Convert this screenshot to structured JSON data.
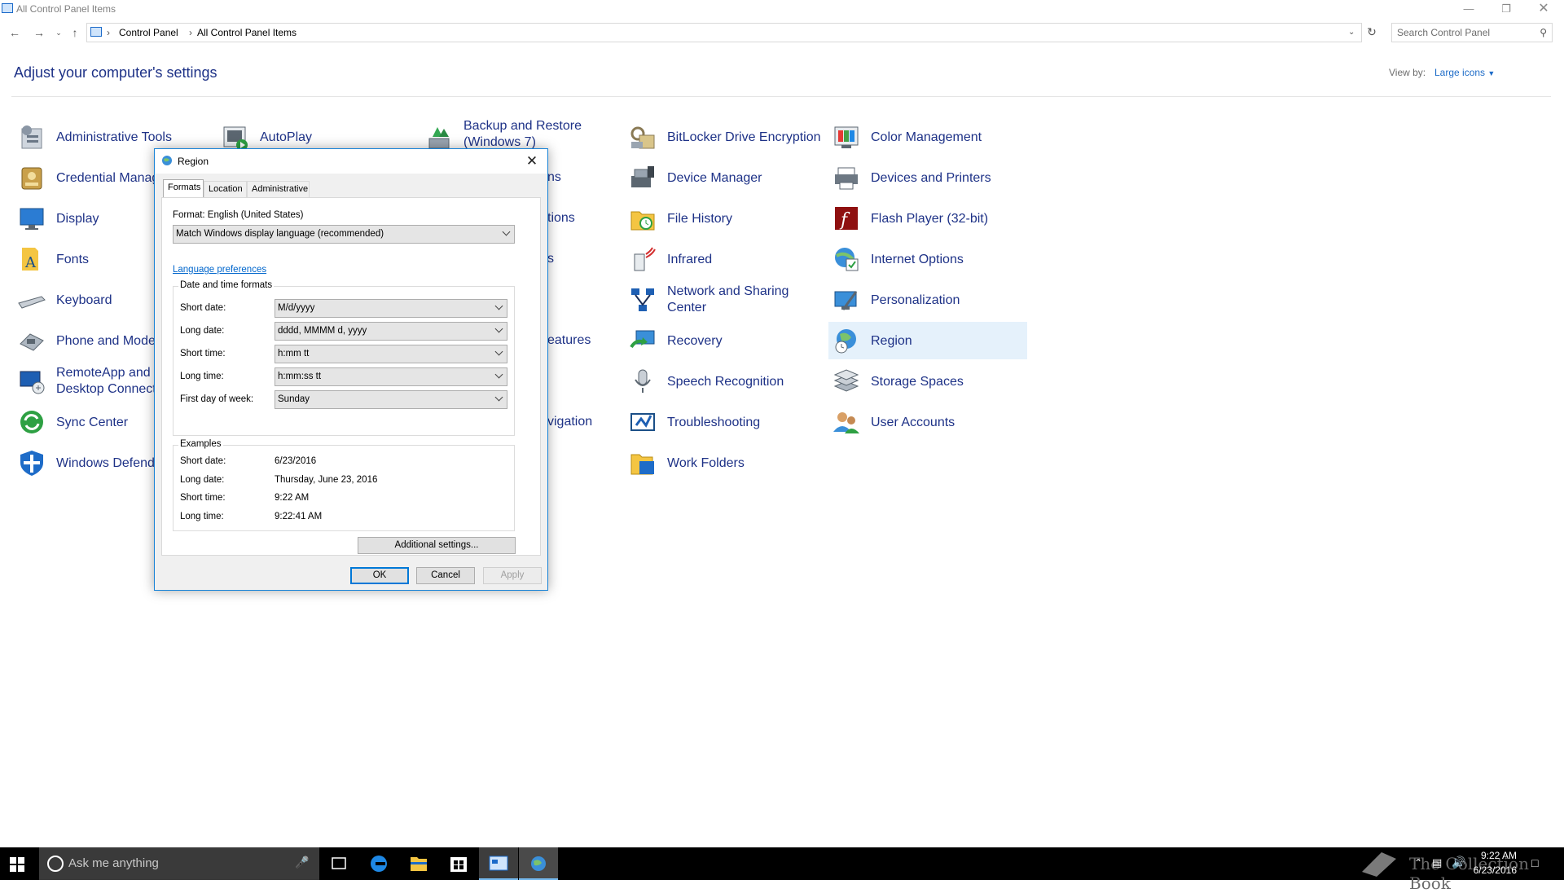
{
  "window": {
    "title": "All Control Panel Items",
    "minimize_icon": "minimize-icon",
    "maximize_icon": "restore-icon",
    "close_icon": "close-icon"
  },
  "address": {
    "crumbs": [
      "Control Panel",
      "All Control Panel Items"
    ],
    "search_placeholder": "Search Control Panel"
  },
  "header": {
    "title": "Adjust your computer's settings",
    "view_by_label": "View by:",
    "view_by_value": "Large icons"
  },
  "items": [
    {
      "label": "Administrative Tools",
      "icon": "admin-tools-icon"
    },
    {
      "label": "AutoPlay",
      "icon": "autoplay-icon"
    },
    {
      "label": "Backup and Restore (Windows 7)",
      "icon": "backup-icon"
    },
    {
      "label": "BitLocker Drive Encryption",
      "icon": "bitlocker-icon"
    },
    {
      "label": "Color Management",
      "icon": "color-management-icon"
    },
    {
      "label": "Credential Manager",
      "icon": "credential-icon"
    },
    {
      "label": "Device Manager",
      "icon": "device-manager-icon"
    },
    {
      "label": "Devices and Printers",
      "icon": "printer-icon"
    },
    {
      "label": "Display",
      "icon": "display-icon"
    },
    {
      "label": "File History",
      "icon": "file-history-icon"
    },
    {
      "label": "Flash Player (32-bit)",
      "icon": "flash-icon"
    },
    {
      "label": "Fonts",
      "icon": "fonts-icon"
    },
    {
      "label": "Infrared",
      "icon": "infrared-icon"
    },
    {
      "label": "Internet Options",
      "icon": "internet-options-icon"
    },
    {
      "label": "Keyboard",
      "icon": "keyboard-icon"
    },
    {
      "label": "Network and Sharing Center",
      "icon": "network-icon"
    },
    {
      "label": "Personalization",
      "icon": "personalization-icon"
    },
    {
      "label": "Phone and Modem",
      "icon": "phone-icon"
    },
    {
      "label": "Recovery",
      "icon": "recovery-icon"
    },
    {
      "label": "Region",
      "icon": "region-icon"
    },
    {
      "label": "RemoteApp and Desktop Connections",
      "icon": "remoteapp-icon"
    },
    {
      "label": "Speech Recognition",
      "icon": "microphone-icon"
    },
    {
      "label": "Storage Spaces",
      "icon": "storage-icon"
    },
    {
      "label": "Sync Center",
      "icon": "sync-icon"
    },
    {
      "label": "Troubleshooting",
      "icon": "troubleshoot-icon"
    },
    {
      "label": "User Accounts",
      "icon": "user-accounts-icon"
    },
    {
      "label": "Windows Defender",
      "icon": "defender-icon"
    },
    {
      "label": "Work Folders",
      "icon": "work-folders-icon"
    }
  ],
  "hidden_fragments": [
    "ns",
    "tions",
    "s",
    "eatures",
    "vigation"
  ],
  "dialog": {
    "title": "Region",
    "tabs": [
      "Formats",
      "Location",
      "Administrative"
    ],
    "format_label": "Format: English (United States)",
    "format_value": "Match Windows display language (recommended)",
    "language_link": "Language preferences",
    "datetime_group": "Date and time formats",
    "fields": [
      {
        "label": "Short date:",
        "value": "M/d/yyyy"
      },
      {
        "label": "Long date:",
        "value": "dddd, MMMM d, yyyy"
      },
      {
        "label": "Short time:",
        "value": "h:mm tt"
      },
      {
        "label": "Long time:",
        "value": "h:mm:ss tt"
      },
      {
        "label": "First day of week:",
        "value": "Sunday"
      }
    ],
    "examples_group": "Examples",
    "examples": [
      {
        "label": "Short date:",
        "value": "6/23/2016"
      },
      {
        "label": "Long date:",
        "value": "Thursday, June 23, 2016"
      },
      {
        "label": "Short time:",
        "value": "9:22 AM"
      },
      {
        "label": "Long time:",
        "value": "9:22:41 AM"
      }
    ],
    "additional_button": "Additional settings...",
    "ok": "OK",
    "cancel": "Cancel",
    "apply": "Apply"
  },
  "taskbar": {
    "search_placeholder": "Ask me anything",
    "time": "9:22 AM",
    "date": "6/23/2016",
    "watermark": "The Collection Book"
  },
  "colors": {
    "link": "#1e3287",
    "accent": "#0078d7",
    "selection": "#e5f1fb"
  }
}
